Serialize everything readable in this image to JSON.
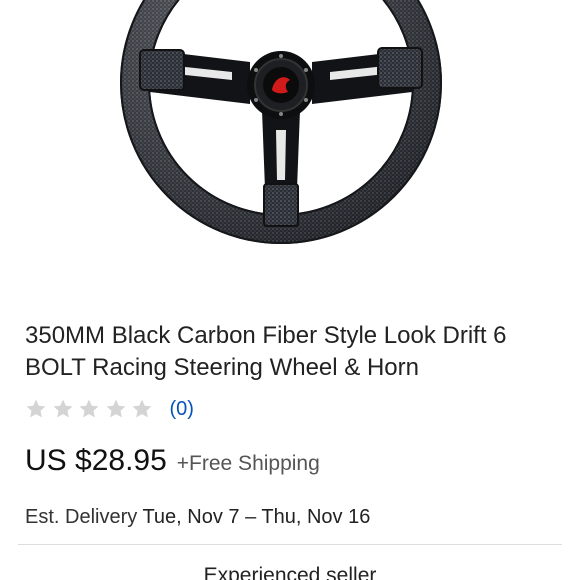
{
  "product": {
    "image_alt": "Steering wheel product photo",
    "title": "350MM Black Carbon Fiber Style Look Drift 6 BOLT Racing Steering Wheel & Horn"
  },
  "rating": {
    "stars_filled": 0,
    "stars_total": 5,
    "review_count": "(0)",
    "star_color": "#d4d4d4",
    "link_color": "#0654ba"
  },
  "pricing": {
    "price": "US $28.95",
    "shipping": "+Free Shipping"
  },
  "delivery": {
    "label": "Est. Delivery",
    "dates": "Tue, Nov 7 – Thu, Nov 16"
  },
  "seller": {
    "badge_text": "Experienced seller"
  }
}
